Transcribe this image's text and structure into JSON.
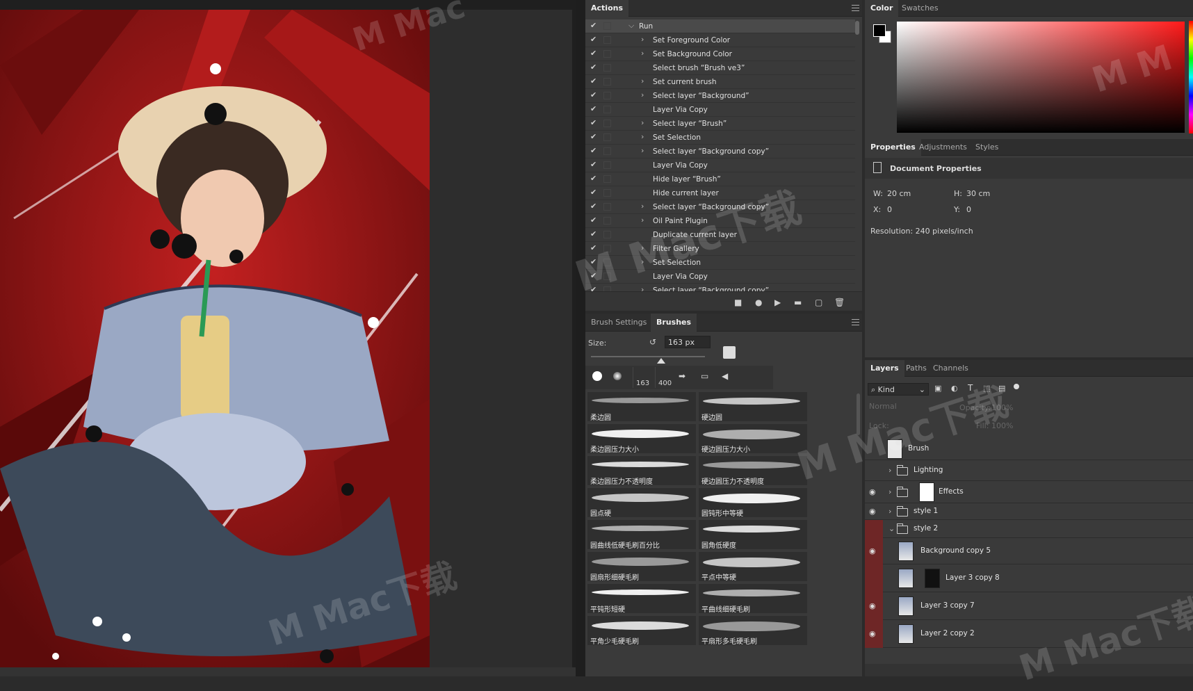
{
  "actions": {
    "tab": "Actions",
    "run_label": "Run",
    "items": [
      {
        "label": "Set Foreground Color",
        "expandable": true
      },
      {
        "label": "Set Background Color",
        "expandable": true
      },
      {
        "label": "Select brush “Brush ve3”",
        "expandable": false
      },
      {
        "label": "Set current brush",
        "expandable": true
      },
      {
        "label": "Select layer “Background”",
        "expandable": true
      },
      {
        "label": "Layer Via Copy",
        "expandable": false
      },
      {
        "label": "Select layer “Brush”",
        "expandable": true
      },
      {
        "label": "Set Selection",
        "expandable": true
      },
      {
        "label": "Select layer “Background copy”",
        "expandable": true
      },
      {
        "label": "Layer Via Copy",
        "expandable": false
      },
      {
        "label": "Hide layer “Brush”",
        "expandable": false
      },
      {
        "label": "Hide current layer",
        "expandable": false
      },
      {
        "label": "Select layer “Background copy”",
        "expandable": true
      },
      {
        "label": "Oil Paint Plugin",
        "expandable": true
      },
      {
        "label": "Duplicate current layer",
        "expandable": false
      },
      {
        "label": "Filter Gallery",
        "expandable": true
      },
      {
        "label": "Set Selection",
        "expandable": true
      },
      {
        "label": "Layer Via Copy",
        "expandable": false
      },
      {
        "label": "Select layer “Background copy”",
        "expandable": true
      }
    ]
  },
  "brushes": {
    "tabs": [
      "Brush Settings",
      "Brushes"
    ],
    "size_label": "Size:",
    "size_value": "163 px",
    "presets": [
      {
        "label": "163"
      },
      {
        "label": "400"
      }
    ],
    "items": [
      "柔边圆",
      "硬边圆",
      "柔边圆压力大小",
      "硬边圆压力大小",
      "柔边圆压力不透明度",
      "硬边圆压力不透明度",
      "圆点硬",
      "圆钝形中等硬",
      "圆曲线低硬毛刷百分比",
      "圆角低硬度",
      "圆扇形细硬毛刷",
      "平点中等硬",
      "平钝形短硬",
      "平曲线细硬毛刷",
      "平角少毛硬毛刷",
      "平扇形多毛硬毛刷"
    ]
  },
  "color": {
    "tabs": [
      "Color",
      "Swatches"
    ],
    "foreground": "#000000",
    "background": "#ffffff",
    "hue": "#ff1a1a"
  },
  "properties": {
    "tabs": [
      "Properties",
      "Adjustments",
      "Styles"
    ],
    "title": "Document Properties",
    "w_label": "W:",
    "w_value": "20 cm",
    "h_label": "H:",
    "h_value": "30 cm",
    "x_label": "X:",
    "x_value": "0",
    "y_label": "Y:",
    "y_value": "0",
    "resolution": "Resolution: 240 pixels/inch"
  },
  "layers": {
    "tabs": [
      "Layers",
      "Paths",
      "Channels"
    ],
    "filter_label": "Kind",
    "blend_mode": "Normal",
    "opacity_label": "Opacity:",
    "opacity_value": "100%",
    "lock_label": "Lock:",
    "fill_label": "Fill:",
    "fill_value": "100%",
    "items": [
      {
        "name": "Brush",
        "type": "layer",
        "visible": false
      },
      {
        "name": "Lighting",
        "type": "group",
        "visible": false
      },
      {
        "name": "Effects",
        "type": "group",
        "visible": true
      },
      {
        "name": "style 1",
        "type": "group",
        "visible": true
      },
      {
        "name": "style 2",
        "type": "group",
        "visible": false
      },
      {
        "name": "Background copy 5",
        "type": "layer",
        "visible": true
      },
      {
        "name": "Layer 3 copy 8",
        "type": "layer",
        "visible": false
      },
      {
        "name": "Layer 3 copy 7",
        "type": "layer",
        "visible": true
      },
      {
        "name": "Layer 2 copy 2",
        "type": "layer",
        "visible": true
      }
    ]
  }
}
